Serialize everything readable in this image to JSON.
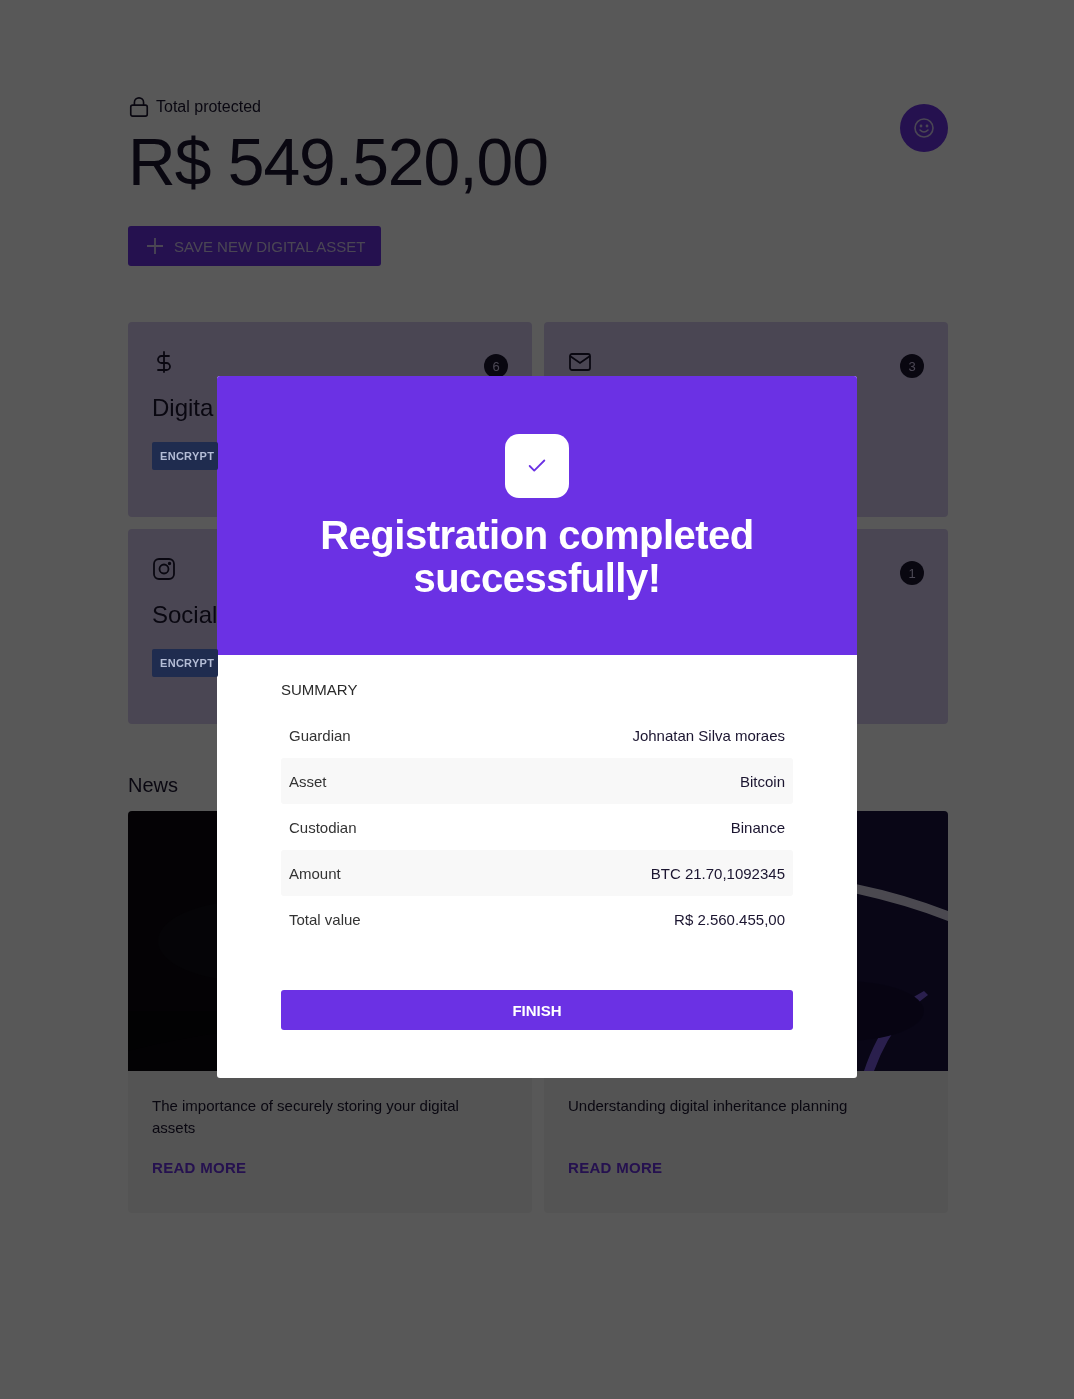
{
  "header": {
    "label": "Total protected",
    "total": "R$ 549.520,00",
    "add_button": "SAVE NEW DIGITAL ASSET"
  },
  "category_rows": [
    {
      "cards": [
        {
          "kind": "dollar",
          "title": "Digita",
          "tag": "ENCRYPT",
          "count": "6"
        },
        {
          "kind": "mail",
          "count": "3"
        }
      ]
    },
    {
      "cards": [
        {
          "kind": "instagram",
          "title": "Social",
          "tag": "ENCRYPT"
        },
        {
          "count": "1"
        }
      ]
    }
  ],
  "news": {
    "title": "News",
    "articles": [
      {
        "title": "The importance of securely storing your digital assets",
        "link": "READ MORE"
      },
      {
        "title": "Understanding digital inheritance planning",
        "link": "READ MORE"
      }
    ]
  },
  "modal": {
    "title": "Registration completed successfully!",
    "summary_title": "SUMMARY",
    "rows": [
      {
        "label": "Guardian",
        "value": "Johnatan Silva moraes"
      },
      {
        "label": "Asset",
        "value": "Bitcoin"
      },
      {
        "label": "Custodian",
        "value": "Binance"
      },
      {
        "label": "Amount",
        "value": "BTC 21.70,1092345"
      },
      {
        "label": "Total value",
        "value": "R$ 2.560.455,00"
      }
    ],
    "button": "FINISH"
  }
}
